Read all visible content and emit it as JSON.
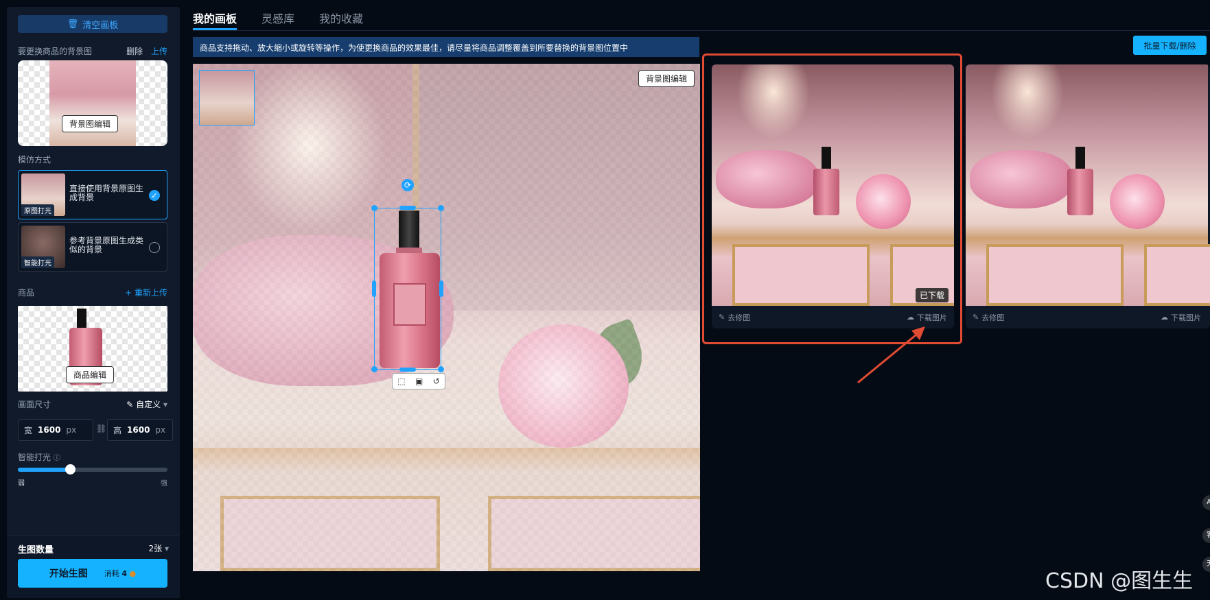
{
  "sidebar": {
    "clear_canvas": "清空画板",
    "bg_section_label": "要更换商品的背景图",
    "bg_delete": "删除",
    "bg_upload": "上传",
    "bg_edit": "背景图编辑",
    "mimic_label": "模仿方式",
    "modes": [
      {
        "tag": "原图打光",
        "text": "直接使用背景原图生成背景",
        "selected": true
      },
      {
        "tag": "智能打光",
        "text": "参考背景原图生成类似的背景",
        "selected": false
      }
    ],
    "product_label": "商品",
    "product_reupload": "+ 重新上传",
    "product_edit": "商品编辑",
    "canvas_size_label": "画面尺寸",
    "custom_label": "自定义",
    "width_key": "宽",
    "width_value": "1600",
    "height_key": "高",
    "height_value": "1600",
    "unit": "px",
    "lighting_label": "智能打光",
    "lighting_weak": "弱",
    "lighting_strong": "强",
    "lighting_level": 0.35,
    "count_label": "生图数量",
    "count_value": "2张",
    "start_label": "开始生图",
    "cost_label": "消耗",
    "cost_value": "4"
  },
  "tabs": [
    {
      "label": "我的画板",
      "active": true
    },
    {
      "label": "灵感库",
      "active": false
    },
    {
      "label": "我的收藏",
      "active": false
    }
  ],
  "canvas": {
    "tip": "商品支持拖动、放大缩小或旋转等操作，为使更换商品的效果最佳，请尽量将商品调整覆盖到所要替换的背景图位置中",
    "bg_edit_chip": "背景图编辑"
  },
  "results": {
    "batch_button": "批量下载/删除",
    "items": [
      {
        "downloaded_tag": "已下载",
        "retouch": "去修图",
        "download": "下载图片"
      },
      {
        "retouch": "去修图",
        "download": "下载图片"
      }
    ]
  },
  "side_bubbles": [
    "AI",
    "客",
    "天"
  ],
  "watermark": "CSDN @图生生",
  "colors": {
    "accent": "#1fa3ff",
    "highlight": "#e14b34",
    "background": "#050b14"
  }
}
